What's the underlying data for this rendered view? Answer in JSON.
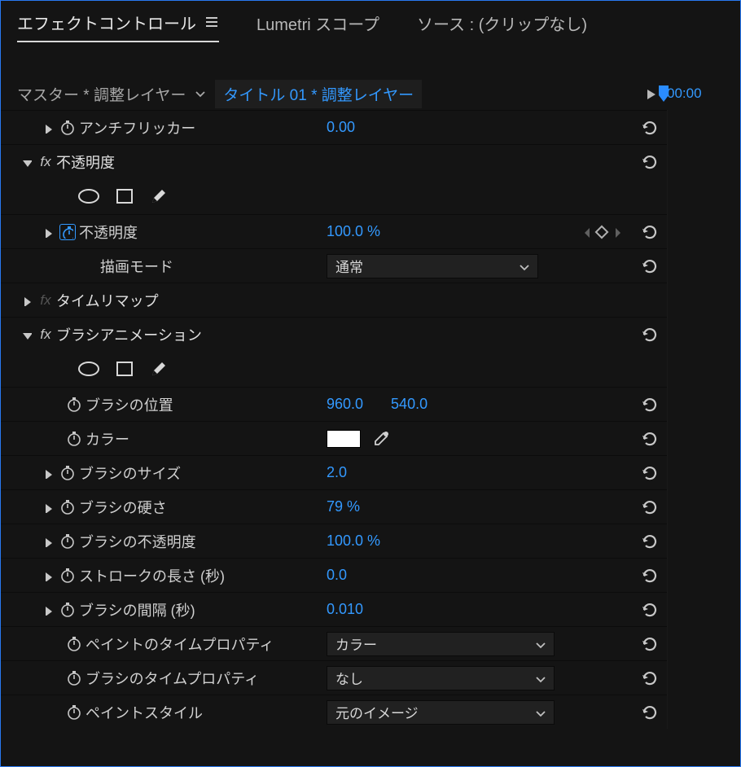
{
  "tabs": {
    "effect_controls": "エフェクトコントロール",
    "lumetri": "Lumetri スコープ",
    "source": "ソース : (クリップなし)"
  },
  "crumb": {
    "master": "マスター * 調整レイヤー",
    "sequence": "タイトル 01 * 調整レイヤー",
    "timecode": "00:00"
  },
  "antiflicker": {
    "label": "アンチフリッカー",
    "value": "0.00"
  },
  "opacity": {
    "title": "不透明度",
    "prop_label": "不透明度",
    "value": "100.0 %",
    "blend_label": "描画モード",
    "blend_value": "通常"
  },
  "timeremap": {
    "title": "タイムリマップ"
  },
  "brush": {
    "title": "ブラシアニメーション",
    "pos_label": "ブラシの位置",
    "pos_x": "960.0",
    "pos_y": "540.0",
    "color_label": "カラー",
    "size_label": "ブラシのサイズ",
    "size_value": "2.0",
    "hard_label": "ブラシの硬さ",
    "hard_value": "79 %",
    "opac_label": "ブラシの不透明度",
    "opac_value": "100.0 %",
    "stroke_label": "ストロークの長さ (秒)",
    "stroke_value": "0.0",
    "spacing_label": "ブラシの間隔 (秒)",
    "spacing_value": "0.010",
    "paint_time_label": "ペイントのタイムプロパティ",
    "paint_time_value": "カラー",
    "brush_time_label": "ブラシのタイムプロパティ",
    "brush_time_value": "なし",
    "style_label": "ペイントスタイル",
    "style_value": "元のイメージ"
  }
}
